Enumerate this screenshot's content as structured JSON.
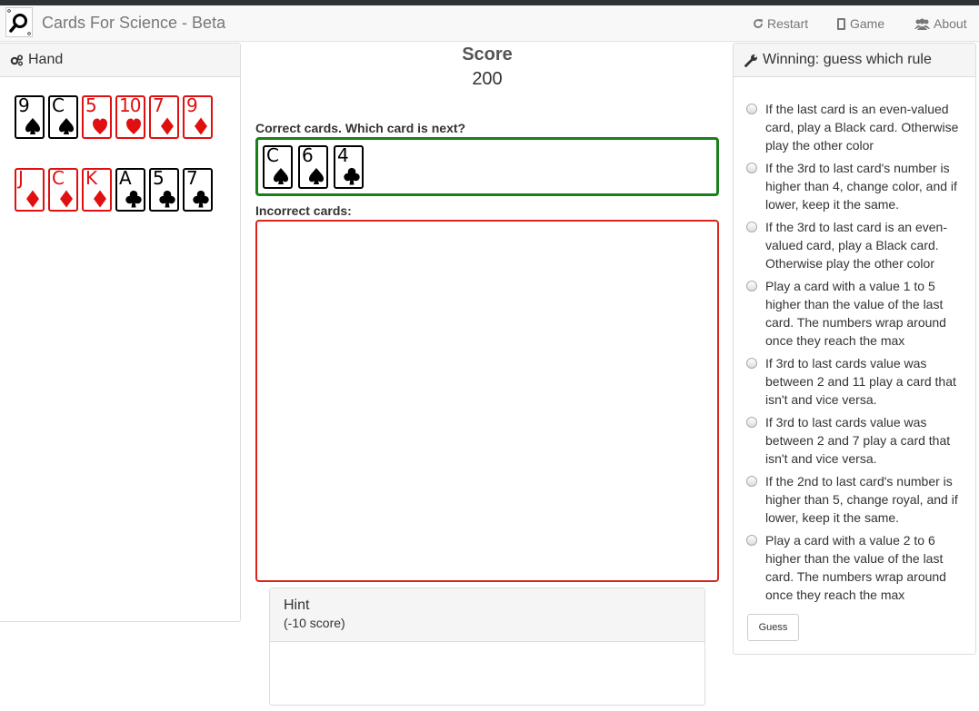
{
  "navbar": {
    "brand": "Cards For Science - Beta",
    "restart_label": "Restart",
    "game_label": "Game",
    "about_label": "About"
  },
  "hand": {
    "title": "Hand",
    "rows": [
      [
        {
          "rank": "9",
          "suit": "spade",
          "color": "black"
        },
        {
          "rank": "C",
          "suit": "spade",
          "color": "black"
        },
        {
          "rank": "5",
          "suit": "heart",
          "color": "red"
        },
        {
          "rank": "10",
          "suit": "heart",
          "color": "red"
        },
        {
          "rank": "7",
          "suit": "diamond",
          "color": "red"
        },
        {
          "rank": "9",
          "suit": "diamond",
          "color": "red"
        }
      ],
      [
        {
          "rank": "J",
          "suit": "diamond",
          "color": "red"
        },
        {
          "rank": "C",
          "suit": "diamond",
          "color": "red"
        },
        {
          "rank": "K",
          "suit": "diamond",
          "color": "red"
        },
        {
          "rank": "A",
          "suit": "club",
          "color": "black"
        },
        {
          "rank": "5",
          "suit": "club",
          "color": "black"
        },
        {
          "rank": "7",
          "suit": "club",
          "color": "black"
        }
      ]
    ]
  },
  "score": {
    "title": "Score",
    "value": "200"
  },
  "correct": {
    "label": "Correct cards. Which card is next?",
    "cards": [
      {
        "rank": "C",
        "suit": "spade",
        "color": "black"
      },
      {
        "rank": "6",
        "suit": "spade",
        "color": "black"
      },
      {
        "rank": "4",
        "suit": "club",
        "color": "black"
      }
    ]
  },
  "incorrect": {
    "label": "Incorrect cards:",
    "cards": []
  },
  "hint": {
    "title": "Hint",
    "cost": "(-10 score)"
  },
  "rules": {
    "title": "Winning: guess which rule",
    "options": [
      "If the last card is an even-valued card, play a Black card. Otherwise play the other color",
      "If the 3rd to last card's number is higher than 4, change color, and if lower, keep it the same.",
      "If the 3rd to last card is an even-valued card, play a Black card. Otherwise play the other color",
      "Play a card with a value 1 to 5 higher than the value of the last card. The numbers wrap around once they reach the max",
      "If 3rd to last cards value was between 2 and 11 play a card that isn't and vice versa.",
      "If 3rd to last cards value was between 2 and 7 play a card that isn't and vice versa.",
      "If the 2nd to last card's number is higher than 5, change royal, and if lower, keep it the same.",
      "Play a card with a value 2 to 6 higher than the value of the last card. The numbers wrap around once they reach the max"
    ],
    "guess_label": "Guess"
  },
  "colors": {
    "red_card": "#e01010",
    "black_card": "#000000",
    "correct_border": "#1a7f1a",
    "incorrect_border": "#d9231c"
  }
}
